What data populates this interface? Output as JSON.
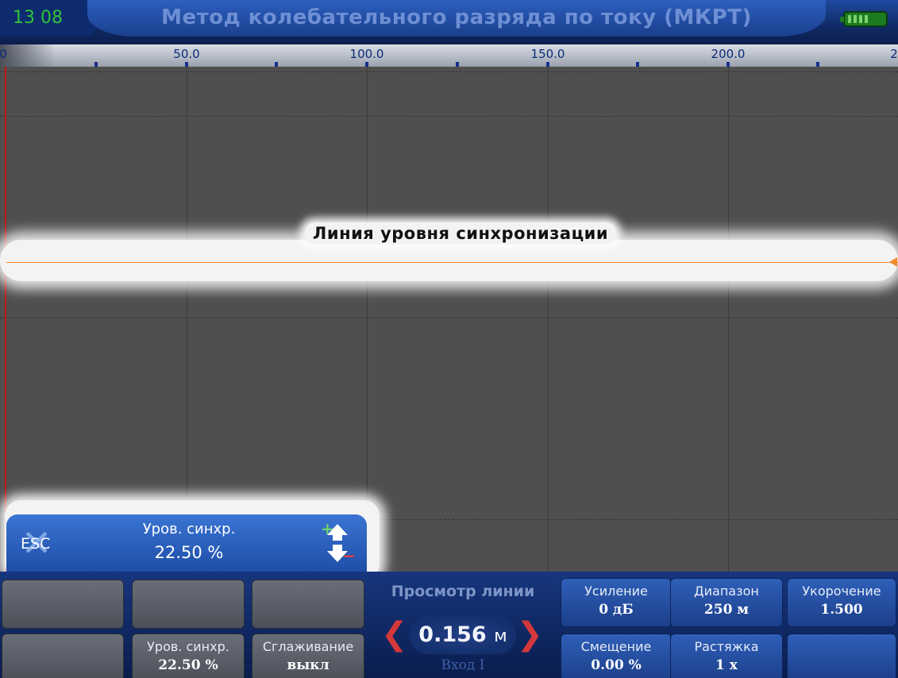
{
  "header": {
    "clock": "13 08",
    "title": "Метод колебательного разряда по току (МКРТ)",
    "battery_icon": "battery-charging-icon"
  },
  "ruler": {
    "start_label": "0",
    "labels": [
      "50.0",
      "100.0",
      "150.0",
      "200.0",
      "2"
    ]
  },
  "plot": {
    "sync_label": "Линия уровня синхронизации",
    "background": "#4f4f4f",
    "sync_line_color": "#f08a2a",
    "axis_color": "#c21616"
  },
  "popup": {
    "esc_label": "ESC",
    "name": "Уров. синхр.",
    "value": "22.50 %",
    "plus": "+",
    "minus": "−"
  },
  "softkeys": {
    "row1": [
      "",
      "",
      ""
    ],
    "row2": [
      {
        "label": "",
        "value": ""
      },
      {
        "label": "Уров. синхр.",
        "value": "22.50 %"
      },
      {
        "label": "Сглаживание",
        "value": "выкл"
      }
    ]
  },
  "line_view": {
    "title": "Просмотр линии",
    "value": "0.156",
    "unit": "м",
    "input": "Вход I",
    "left_arrow": "❮",
    "right_arrow": "❯"
  },
  "params": {
    "gain": {
      "label": "Усиление",
      "value": "0 дБ"
    },
    "range": {
      "label": "Диапазон",
      "value": "250 м"
    },
    "shortening": {
      "label": "Укорочение",
      "value": "1.500"
    },
    "offset": {
      "label": "Смещение",
      "value": "0.00 %"
    },
    "stretch": {
      "label": "Растяжка",
      "value": "1 x"
    },
    "empty": {
      "label": "",
      "value": ""
    }
  },
  "colors": {
    "accent": "#1f4ea8",
    "clock": "#31c23a",
    "arrows": "#d4383b"
  }
}
